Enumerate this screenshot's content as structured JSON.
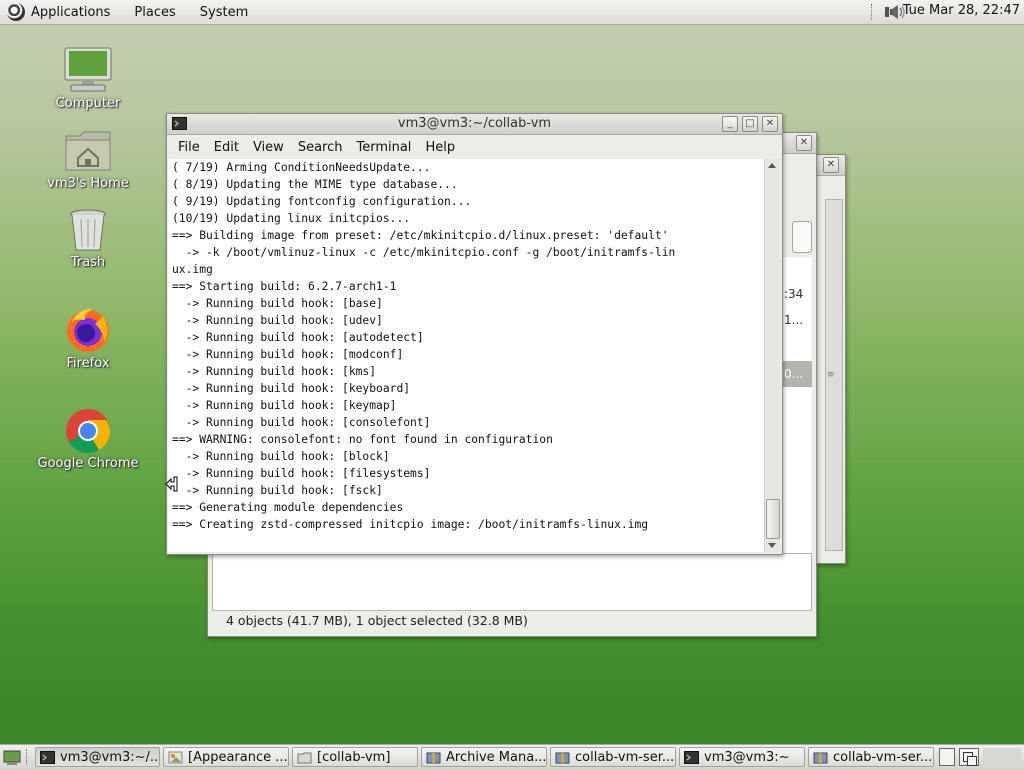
{
  "top_panel": {
    "menus": [
      "Applications",
      "Places",
      "System"
    ],
    "clock": "Tue Mar 28, 22:47"
  },
  "desktop_icons": [
    {
      "label": "Computer",
      "icon": "computer-icon"
    },
    {
      "label": "vm3's Home",
      "icon": "home-folder-icon"
    },
    {
      "label": "Trash",
      "icon": "trash-icon"
    },
    {
      "label": "Firefox",
      "icon": "firefox-icon"
    },
    {
      "label": "Google Chrome",
      "icon": "chrome-icon"
    }
  ],
  "terminal": {
    "title": "vm3@vm3:~/collab-vm",
    "menus": [
      "File",
      "Edit",
      "View",
      "Search",
      "Terminal",
      "Help"
    ],
    "lines": [
      "( 7/19) Arming ConditionNeedsUpdate...",
      "( 8/19) Updating the MIME type database...",
      "( 9/19) Updating fontconfig configuration...",
      "(10/19) Updating linux initcpios...",
      "==> Building image from preset: /etc/mkinitcpio.d/linux.preset: 'default'",
      "  -> -k /boot/vmlinuz-linux -c /etc/mkinitcpio.conf -g /boot/initramfs-lin",
      "ux.img",
      "==> Starting build: 6.2.7-arch1-1",
      "  -> Running build hook: [base]",
      "  -> Running build hook: [udev]",
      "  -> Running build hook: [autodetect]",
      "  -> Running build hook: [modconf]",
      "  -> Running build hook: [kms]",
      "  -> Running build hook: [keyboard]",
      "  -> Running build hook: [keymap]",
      "  -> Running build hook: [consolefont]",
      "==> WARNING: consolefont: no font found in configuration",
      "  -> Running build hook: [block]",
      "  -> Running build hook: [filesystems]",
      "  -> Running build hook: [fsck]",
      "==> Generating module dependencies",
      "==> Creating zstd-compressed initcpio image: /boot/initramfs-linux.img"
    ]
  },
  "file_manager": {
    "status": "4 objects (41.7 MB), 1 object selected (32.8 MB)",
    "partial_cells": [
      ":34",
      "1...",
      "0..."
    ]
  },
  "taskbar": {
    "tasks": [
      {
        "label": "vm3@vm3:~/...",
        "icon": "terminal-icon",
        "active": true
      },
      {
        "label": "[Appearance ...",
        "icon": "appearance-icon",
        "active": false
      },
      {
        "label": "[collab-vm]",
        "icon": "folder-icon",
        "active": false
      },
      {
        "label": "Archive Mana...",
        "icon": "archive-icon",
        "active": false
      },
      {
        "label": "collab-vm-ser...",
        "icon": "archive-icon",
        "active": false
      },
      {
        "label": "vm3@vm3:~",
        "icon": "terminal-icon",
        "active": false
      },
      {
        "label": "collab-vm-ser...",
        "icon": "archive-icon",
        "active": false
      }
    ]
  }
}
